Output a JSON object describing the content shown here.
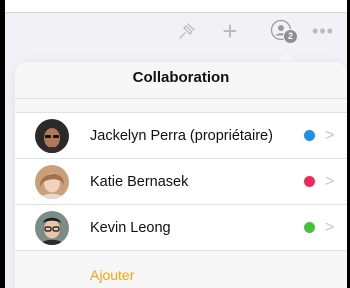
{
  "popover": {
    "title": "Collaboration",
    "add_label": "Ajouter"
  },
  "toolbar": {
    "collaborator_count": "2",
    "more_glyph": "•••"
  },
  "collaborators": [
    {
      "name": "Jackelyn Perra (propriétaire)",
      "color": "#1e90e8"
    },
    {
      "name": "Katie Bernasek",
      "color": "#f2275a"
    },
    {
      "name": "Kevin Leong",
      "color": "#46c13b"
    }
  ],
  "colors": {
    "accent": "#ff9f0a"
  }
}
